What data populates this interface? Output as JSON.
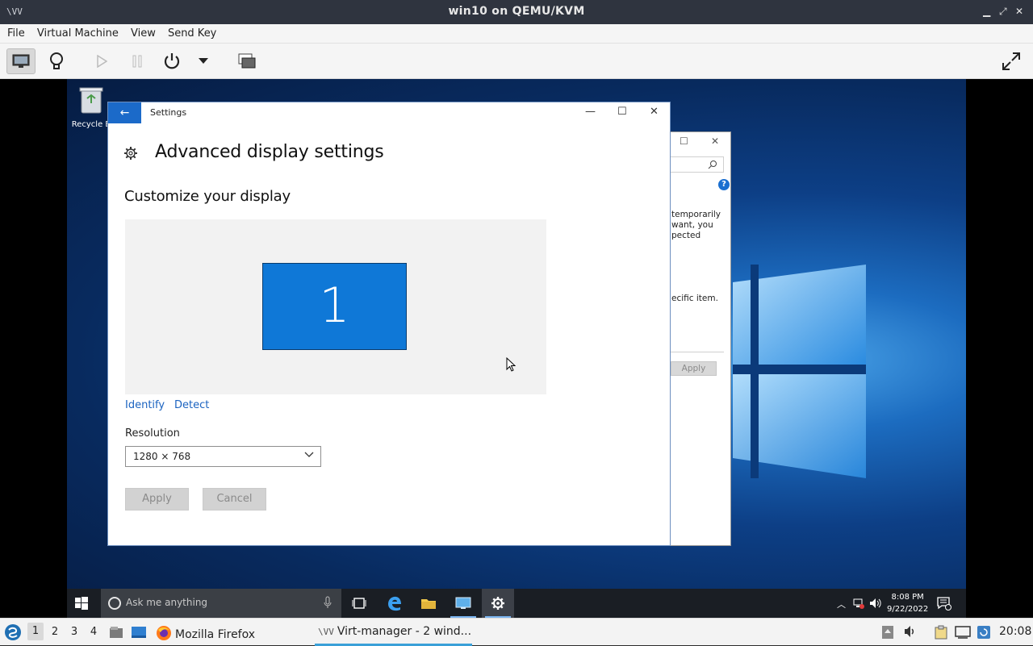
{
  "host": {
    "window_title": "win10 on QEMU/KVM",
    "title_buttons": [
      "▁",
      "⤢",
      "✕"
    ],
    "menu": [
      "File",
      "Virtual Machine",
      "View",
      "Send Key"
    ]
  },
  "desktop": {
    "recycle_bin_label": "Recycle B"
  },
  "behind_dialog": {
    "lines": [
      "temporarily",
      "want, you",
      "pected",
      "ecific item."
    ],
    "apply_label": "Apply"
  },
  "settings": {
    "window_title": "Settings",
    "back_glyph": "←",
    "page_title": "Advanced display settings",
    "section_title": "Customize your display",
    "monitor_number": "1",
    "identify_label": "Identify",
    "detect_label": "Detect",
    "resolution_label": "Resolution",
    "resolution_value": "1280 × 768",
    "apply_label": "Apply",
    "cancel_label": "Cancel"
  },
  "taskbar": {
    "search_placeholder": "Ask me anything",
    "time": "8:08 PM",
    "date": "9/22/2022"
  },
  "panel": {
    "workspaces": [
      "1",
      "2",
      "3",
      "4"
    ],
    "current_workspace": "1",
    "tasks": [
      "Mozilla Firefox",
      "Virt-manager - 2 wind..."
    ],
    "clock": "20:08"
  }
}
